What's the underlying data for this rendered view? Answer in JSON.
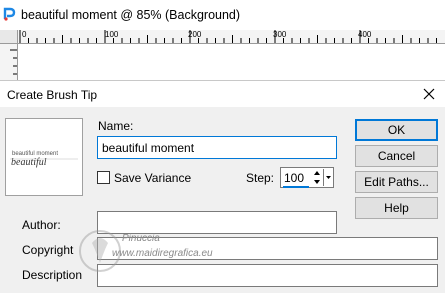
{
  "document": {
    "title": "beautiful moment @  85% (Background)",
    "ruler_labels": [
      "0",
      "100",
      "200",
      "300",
      "400"
    ]
  },
  "dialog": {
    "title": "Create Brush Tip",
    "preview": {
      "text_top": "beautiful  moment",
      "text_script": "beautiful"
    },
    "name_label": "Name:",
    "name_value": "beautiful moment",
    "save_variance_label": "Save Variance",
    "save_variance_checked": false,
    "step_label": "Step:",
    "step_value": "100",
    "buttons": {
      "ok": "OK",
      "cancel": "Cancel",
      "edit_paths": "Edit Paths...",
      "help": "Help"
    },
    "author_label": "Author:",
    "author_value": "",
    "copyright_label": "Copyright",
    "copyright_value": "",
    "description_label": "Description",
    "description_value": ""
  },
  "watermark": {
    "line1": "Pinuccia",
    "line2": "www.maidiregrafica.eu"
  },
  "colors": {
    "accent": "#0078d7",
    "dialog_bg": "#f0f0f0",
    "button_bg": "#e1e1e1"
  }
}
